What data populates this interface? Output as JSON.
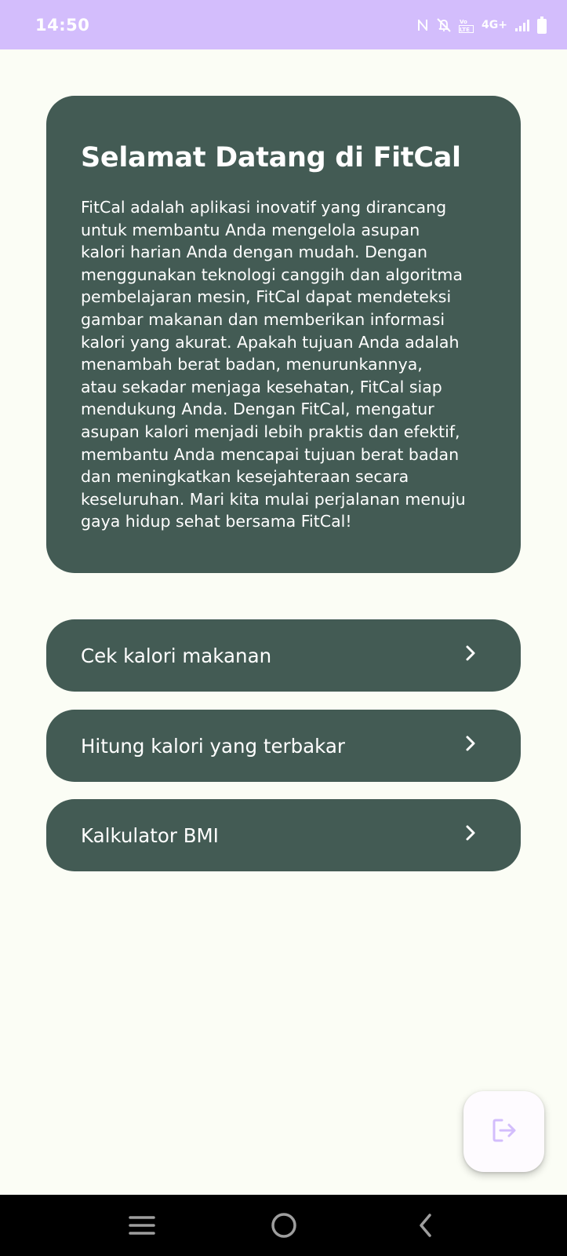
{
  "status_bar": {
    "time": "14:50",
    "network_label": "4G+",
    "icons": [
      "nfc-icon",
      "mute-icon",
      "volte-icon",
      "signal-icon",
      "battery-icon"
    ]
  },
  "welcome": {
    "title": "Selamat Datang di FitCal",
    "body": "FitCal adalah aplikasi inovatif yang dirancang\nuntuk membantu Anda mengelola asupan\nkalori harian Anda dengan mudah. Dengan\nmenggunakan teknologi canggih dan algoritma\npembelajaran mesin, FitCal dapat mendeteksi\ngambar makanan dan memberikan informasi\nkalori yang akurat. Apakah tujuan Anda adalah\nmenambah berat badan, menurunkannya,\natau sekadar menjaga kesehatan, FitCal siap\nmendukung Anda. Dengan FitCal, mengatur\nasupan kalori menjadi lebih praktis dan efektif,\nmembantu Anda mencapai tujuan berat badan\ndan meningkatkan kesejahteraan secara\nkeseluruhan. Mari kita mulai perjalanan menuju\ngaya hidup sehat bersama FitCal!"
  },
  "menu": {
    "items": [
      {
        "label": "Cek kalori makanan",
        "icon": "chevron-right-icon"
      },
      {
        "label": "Hitung kalori yang terbakar",
        "icon": "chevron-right-icon"
      },
      {
        "label": "Kalkulator BMI",
        "icon": "chevron-right-icon"
      }
    ]
  },
  "fab": {
    "icon": "logout-icon"
  },
  "nav_bar": {
    "icons": [
      "menu-icon",
      "home-icon",
      "back-icon"
    ]
  },
  "colors": {
    "status_bar": "#d3bdfc",
    "background": "#fbfdf5",
    "card": "#435b54",
    "card_text": "#ffffff",
    "fab_icon": "#d3bdfc"
  }
}
